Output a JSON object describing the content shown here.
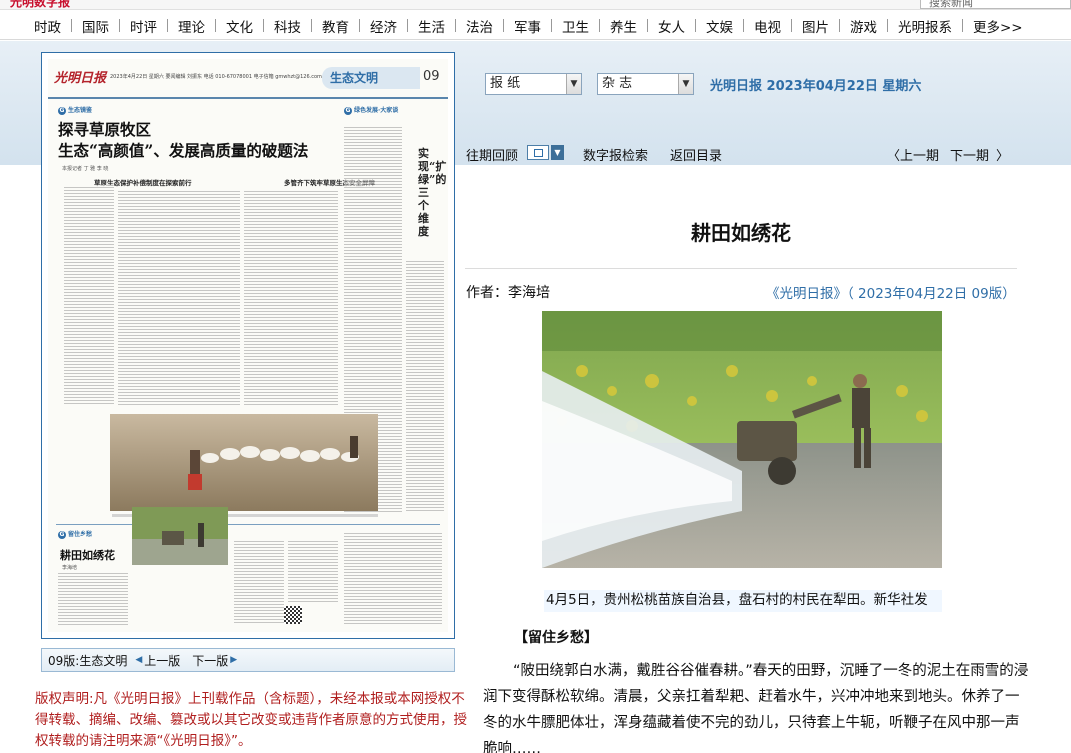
{
  "top": {
    "logo": "光明数字报",
    "search_placeholder": "搜索新闻"
  },
  "nav": [
    "时政",
    "国际",
    "时评",
    "理论",
    "文化",
    "科技",
    "教育",
    "经济",
    "生活",
    "法治",
    "军事",
    "卫生",
    "养生",
    "女人",
    "文娱",
    "电视",
    "图片",
    "游戏",
    "光明报系",
    "更多>>"
  ],
  "paper_preview": {
    "logo": "光明日报",
    "meta": "2023年4月22日  星期六  要闻编辑 刘振东  电话 010-67078001  电子信箱 gmwhzt@126.com  版式编辑 孙宏",
    "section": "生态文明",
    "page_num": "09",
    "tag1": "生态镜鉴",
    "tag2": "绿色发展·大家谈",
    "headline_line1": "探寻草原牧区",
    "headline_line2": "生态“高颜值”、发展高质量的破题法",
    "byline": "本报记者 丁 雅 李 晓",
    "side_title": "实现“扩绿”的三个维度",
    "sub1": "草原生态保护补偿制度在探索前行",
    "sub2": "多管齐下筑牢草原生态安全屏障",
    "tag3": "留住乡愁",
    "article2_title": "耕田如绣花",
    "article2_byline": "李海培"
  },
  "pagebar": {
    "label": "09版:生态文明",
    "prev": "上一版",
    "next": "下一版"
  },
  "copyright": "版权声明:凡《光明日报》上刊载作品（含标题），未经本报或本网授权不得转载、摘编、改编、篡改或以其它改变或违背作者原意的方式使用，授权转载的请注明来源“《光明日报》”。",
  "controls": {
    "paper_select": "报 纸",
    "edition_select": "杂 志",
    "date_heading": "光明日报  2023年04月22日  星期六"
  },
  "toolbar": {
    "history": "往期回顾",
    "digital_search": "数字报检索",
    "back_to_index": "返回目录",
    "prev_page": "上一期",
    "next_page": "下一期"
  },
  "article": {
    "title": "耕田如绣花",
    "author": "作者：李海培",
    "source": "《光明日报》（ 2023年04月22日 09版）",
    "caption": "4月5日，贵州松桃苗族自治县，盘石村的村民在犁田。新华社发",
    "section_head": "【留住乡愁】",
    "body": "“陂田绕郭白水满，戴胜谷谷催春耕。”春天的田野，沉睡了一冬的泥土在雨雪的浸润下变得酥松软绵。清晨，父亲扛着犁耙、赶着水牛，兴冲冲地来到地头。休养了一冬的水牛膘肥体壮，浑身蕴藏着使不完的劲儿，只待套上牛轭，听鞭子在风中那一声脆响……"
  },
  "colors": {
    "accent_blue": "#2f6ea7",
    "copyright_red": "#b01e1e",
    "band": "#d3e2ee"
  }
}
